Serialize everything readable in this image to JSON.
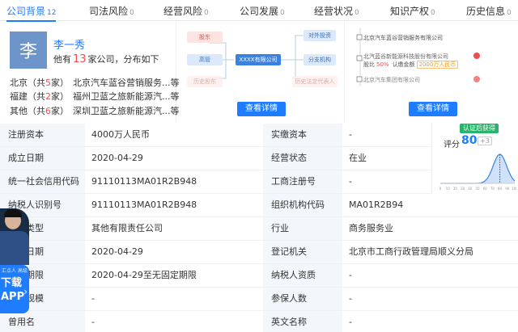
{
  "tabs": [
    {
      "label": "公司背景",
      "count": "12",
      "active": true
    },
    {
      "label": "司法风险",
      "count": "0"
    },
    {
      "label": "经营风险",
      "count": "0"
    },
    {
      "label": "公司发展",
      "count": "0"
    },
    {
      "label": "经营状况",
      "count": "0"
    },
    {
      "label": "知识产权",
      "count": "0"
    },
    {
      "label": "历史信息",
      "count": "0"
    }
  ],
  "person": {
    "avatar_char": "李",
    "name": "李一秀",
    "line_prefix": "他有",
    "company_count": "13",
    "line_suffix": "家公司，分布如下",
    "regions": [
      {
        "region": "北京",
        "open": "（共",
        "count": "5",
        "close": "家）",
        "company": "北京汽车蓝谷营销服务...等"
      },
      {
        "region": "福建",
        "open": "（共",
        "count": "2",
        "close": "家）",
        "company": "福州卫蓝之旅新能源汽...等"
      },
      {
        "region": "其他",
        "open": "（共",
        "count": "6",
        "close": "家）",
        "company": "深圳卫蓝之旅新能源汽...等"
      }
    ]
  },
  "graph": {
    "shareholder": "股东",
    "executive": "高管",
    "history_shareholder": "历史股东",
    "center": "XXXX有限公司",
    "investment": "对外投资",
    "branch": "分支机构",
    "history_legal": "历史法定代表人",
    "button": "查看详情"
  },
  "chain": {
    "item1": "北京汽车蓝谷营销服务有限公司",
    "item2": "北汽蓝谷新能源科技股份有限公司",
    "item2_ratio_label": "股比",
    "item2_ratio": "50%",
    "item2_capital_label": "认缴金额",
    "item2_capital": "2000万人民币",
    "item3": "北京汽车集团有限公司",
    "button": "查看详情"
  },
  "table": {
    "rows": [
      {
        "l1": "注册资本",
        "v1": "4000万人民币",
        "l2": "实缴资本",
        "v2": "-"
      },
      {
        "l1": "成立日期",
        "v1": "2020-04-29",
        "l2": "经营状态",
        "v2": "在业"
      },
      {
        "l1": "统一社会信用代码",
        "v1": "91110113MA01R2B948",
        "l2": "工商注册号",
        "v2": "-"
      },
      {
        "l1": "纳税人识别号",
        "v1": "91110113MA01R2B948",
        "l2": "组织机构代码",
        "v2": "MA01R2B94"
      },
      {
        "l1": "公司类型",
        "v1": "其他有限责任公司",
        "l2": "行业",
        "v2": "商务服务业"
      },
      {
        "l1": "核准日期",
        "v1": "2020-04-29",
        "l2": "登记机关",
        "v2": "北京市工商行政管理局顺义分局"
      },
      {
        "l1": "营业期限",
        "v1": "2020-04-29至无固定期限",
        "l2": "纳税人资质",
        "v2": "-"
      },
      {
        "l1": "人员规模",
        "v1": "-",
        "l2": "参保人数",
        "v2": "-"
      },
      {
        "l1": "曾用名",
        "v1": "-",
        "l2": "英文名称",
        "v2": "-"
      }
    ]
  },
  "score": {
    "cert": "认证后获得",
    "label": "评分",
    "value": 80,
    "delta": "+3",
    "axis_ticks": [
      "0",
      "10",
      "20",
      "30",
      "40",
      "50",
      "60",
      "70",
      "80",
      "90",
      "100"
    ]
  },
  "ad": {
    "small": "汇点人 高级",
    "big1": "下载",
    "big2": "APP"
  },
  "colors": {
    "accent": "#1e7cff",
    "count_red": "#f04e4e",
    "label_bg": "#f3f6fb",
    "cert_green": "#29b36b"
  }
}
